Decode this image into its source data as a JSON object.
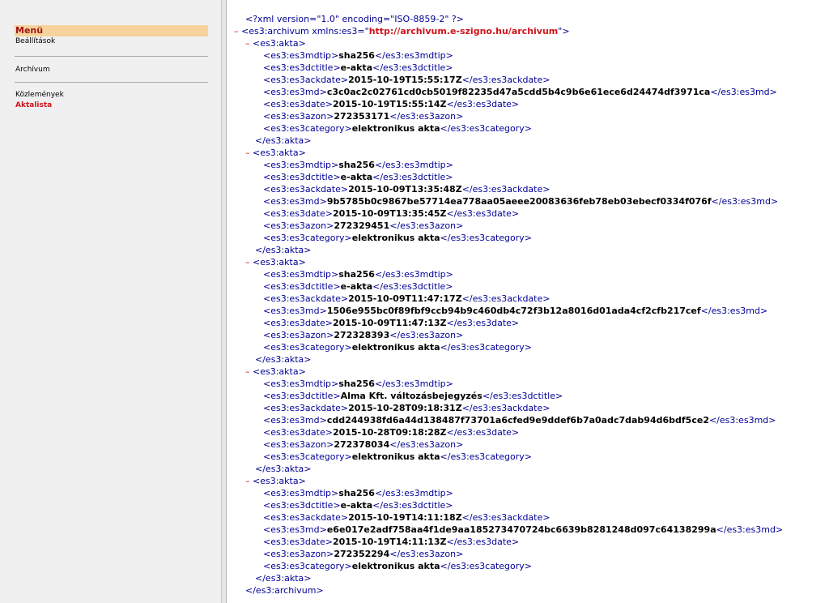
{
  "sidebar": {
    "title": "Menü",
    "groups": [
      [
        "Beállítások"
      ],
      [
        "Archívum"
      ],
      [
        "Közlemények",
        "Aktalista"
      ]
    ]
  },
  "xml": {
    "declaration": "<?xml version=\"1.0\" encoding=\"ISO-8859-2\" ?>",
    "root_open_prefix": "<es3:archivum xmlns:es3=\"",
    "root_ns_url": "http://archivum.e-szigno.hu/archivum",
    "root_open_suffix": "\">",
    "root_close": "</es3:archivum>",
    "collapse_symbol": "–",
    "record_open": "<es3:akta>",
    "record_close": "</es3:akta>",
    "field_tags": [
      "es3:es3mdtip",
      "es3:es3dctitle",
      "es3:es3ackdate",
      "es3:es3md",
      "es3:es3date",
      "es3:es3azon",
      "es3:es3category"
    ],
    "records": [
      {
        "es3mdtip": "sha256",
        "es3dctitle": "e-akta",
        "es3ackdate": "2015-10-19T15:55:17Z",
        "es3md": "c3c0ac2c02761cd0cb5019f82235d47a5cdd5b4c9b6e61ece6d24474df3971ca",
        "es3date": "2015-10-19T15:55:14Z",
        "es3azon": "272353171",
        "es3category": "elektronikus akta"
      },
      {
        "es3mdtip": "sha256",
        "es3dctitle": "e-akta",
        "es3ackdate": "2015-10-09T13:35:48Z",
        "es3md": "9b5785b0c9867be57714ea778aa05aeee20083636feb78eb03ebecf0334f076f",
        "es3date": "2015-10-09T13:35:45Z",
        "es3azon": "272329451",
        "es3category": "elektronikus akta"
      },
      {
        "es3mdtip": "sha256",
        "es3dctitle": "e-akta",
        "es3ackdate": "2015-10-09T11:47:17Z",
        "es3md": "1506e955bc0f89fbf9ccb94b9c460db4c72f3b12a8016d01ada4cf2cfb217cef",
        "es3date": "2015-10-09T11:47:13Z",
        "es3azon": "272328393",
        "es3category": "elektronikus akta"
      },
      {
        "es3mdtip": "sha256",
        "es3dctitle": "Alma Kft. változásbejegyzés",
        "es3ackdate": "2015-10-28T09:18:31Z",
        "es3md": "cdd244938fd6a44d138487f73701a6cfed9e9ddef6b7a0adc7dab94d6bdf5ce2",
        "es3date": "2015-10-28T09:18:28Z",
        "es3azon": "272378034",
        "es3category": "elektronikus akta"
      },
      {
        "es3mdtip": "sha256",
        "es3dctitle": "e-akta",
        "es3ackdate": "2015-10-19T14:11:18Z",
        "es3md": "e6e017e2adf758aa4f1de9aa185273470724bc6639b8281248d097c64138299a",
        "es3date": "2015-10-19T14:11:13Z",
        "es3azon": "272352294",
        "es3category": "elektronikus akta"
      }
    ]
  }
}
